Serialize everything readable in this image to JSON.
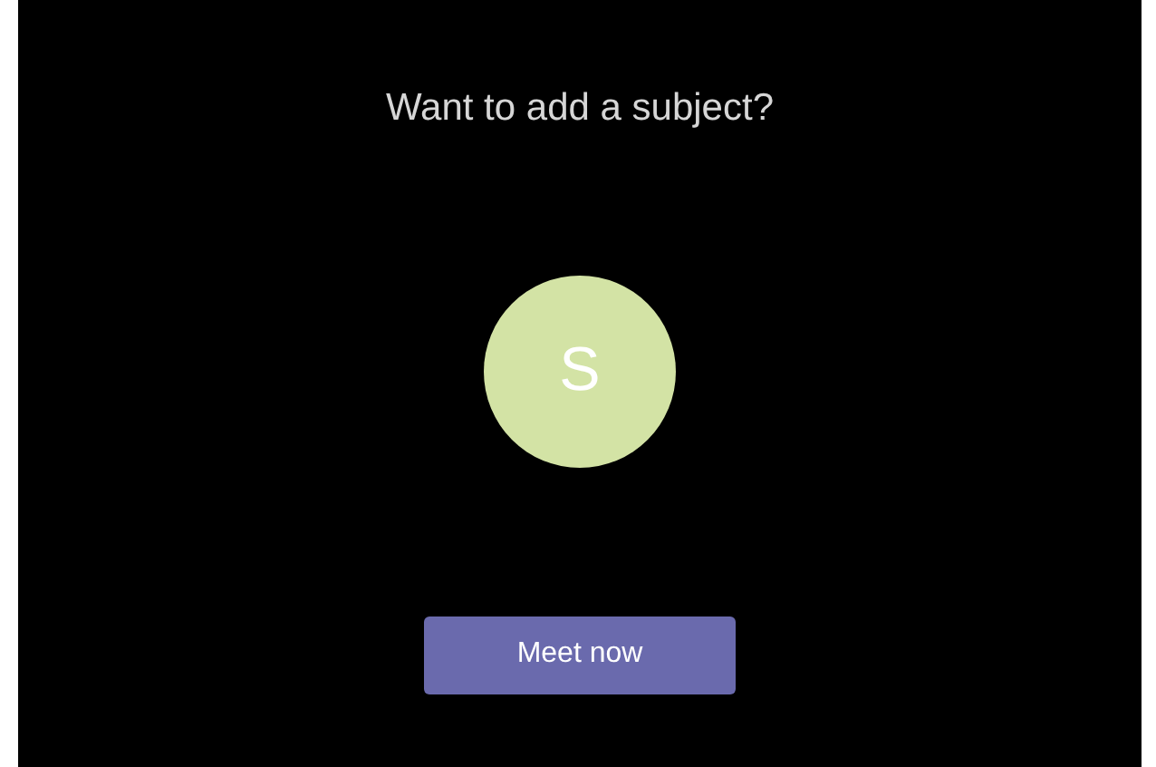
{
  "prompt": "Want to add a subject?",
  "avatar": {
    "initial": "S",
    "color": "#d3e3a5"
  },
  "button": {
    "label": "Meet now"
  }
}
